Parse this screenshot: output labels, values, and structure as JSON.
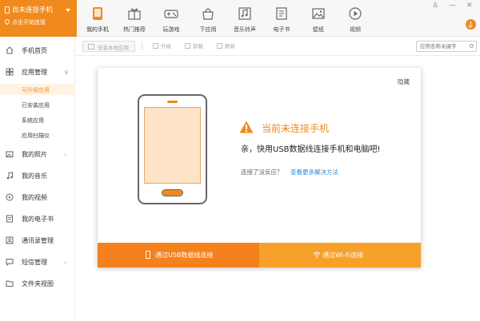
{
  "header": {
    "connect": {
      "title": "尚未连接手机",
      "subtitle": "点击开始连接"
    },
    "nav": [
      {
        "label": "我的手机",
        "icon": "my-phone-icon"
      },
      {
        "label": "热门推荐",
        "icon": "gift-icon"
      },
      {
        "label": "玩游戏",
        "icon": "gamepad-icon"
      },
      {
        "label": "下应用",
        "icon": "app-store-icon"
      },
      {
        "label": "音乐铃声",
        "icon": "music-icon"
      },
      {
        "label": "电子书",
        "icon": "ebook-icon"
      },
      {
        "label": "壁纸",
        "icon": "wallpaper-icon"
      },
      {
        "label": "视频",
        "icon": "video-icon"
      }
    ],
    "window_controls": {
      "user": "♙",
      "minimize": "—",
      "close": "✕"
    }
  },
  "sidebar": {
    "items": [
      {
        "label": "手机首页",
        "icon": "home-icon"
      },
      {
        "label": "应用管理",
        "icon": "apps-icon",
        "expanded": true
      },
      {
        "label": "我的照片",
        "icon": "photo-icon"
      },
      {
        "label": "我的音乐",
        "icon": "music-note-icon"
      },
      {
        "label": "我的视频",
        "icon": "play-circle-icon"
      },
      {
        "label": "我的电子书",
        "icon": "book-icon"
      },
      {
        "label": "通讯录管理",
        "icon": "contacts-icon"
      },
      {
        "label": "短信管理",
        "icon": "sms-icon"
      },
      {
        "label": "文件夹视图",
        "icon": "folder-icon"
      }
    ],
    "app_sub": [
      "可升级应用",
      "已安装应用",
      "系统应用",
      "应用扫描仪"
    ],
    "expand_arrow": "∨",
    "collapse_arrow": "›"
  },
  "toolbar": {
    "install": "安装本地应用",
    "upgrade": "升级",
    "uninstall": "卸载",
    "refresh": "刷新",
    "search_placeholder": "应用名称关键字"
  },
  "dialog": {
    "hide": "隐藏",
    "title": "当前未连接手机",
    "message": "亲，快用USB数据线连接手机和电脑吧!",
    "hint": "连接了没反应？",
    "link": "查看更多解决方法",
    "usb_button": "通过USB数据线连接",
    "wifi_button": "通过Wi-Fi连接"
  },
  "colors": {
    "accent": "#f08a1c",
    "accent_light": "#f7a12a",
    "link": "#2a8bd8",
    "phone_screen": "#fde3c8"
  }
}
